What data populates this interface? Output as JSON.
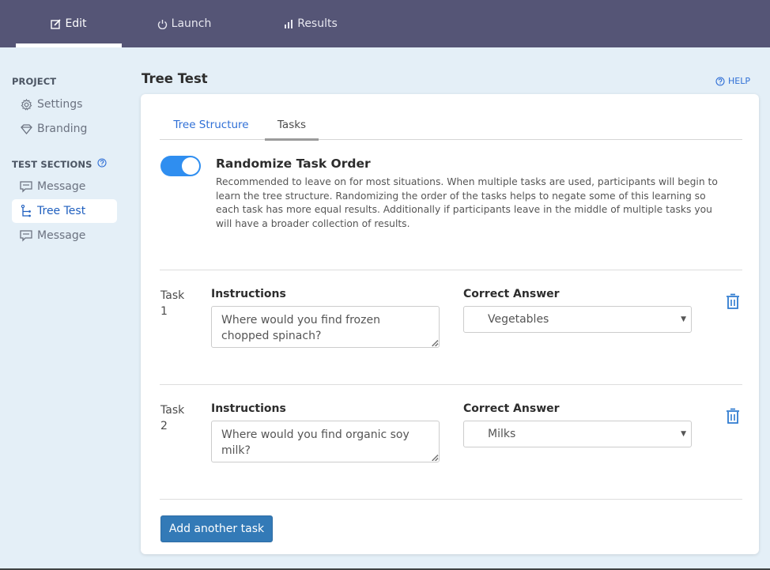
{
  "topnav": {
    "tabs": [
      {
        "label": "Edit",
        "icon": "edit-icon",
        "active": true
      },
      {
        "label": "Launch",
        "icon": "power-icon",
        "active": false
      },
      {
        "label": "Results",
        "icon": "bar-chart-icon",
        "active": false
      }
    ]
  },
  "sidebar": {
    "project_heading": "PROJECT",
    "project_items": [
      {
        "label": "Settings",
        "icon": "gear-icon"
      },
      {
        "label": "Branding",
        "icon": "diamond-icon"
      }
    ],
    "sections_heading": "TEST SECTIONS",
    "section_items": [
      {
        "label": "Message",
        "icon": "message-icon",
        "active": false
      },
      {
        "label": "Tree Test",
        "icon": "tree-icon",
        "active": true
      },
      {
        "label": "Message",
        "icon": "message-icon",
        "active": false
      }
    ]
  },
  "main": {
    "title": "Tree Test",
    "help_label": "HELP",
    "tabs": [
      {
        "label": "Tree Structure",
        "active": false
      },
      {
        "label": "Tasks",
        "active": true
      }
    ],
    "randomize": {
      "enabled": true,
      "title": "Randomize Task Order",
      "description": "Recommended to leave on for most situations. When multiple tasks are used, participants will begin to learn the tree structure. Randomizing the order of the tasks helps to negate some of this learning so each task has more equal results. Additionally if participants leave in the middle of multiple tasks you will have a broader collection of results."
    },
    "instructions_label": "Instructions",
    "answer_label": "Correct Answer",
    "tasks": [
      {
        "label": "Task 1",
        "instructions": "Where would you find frozen chopped spinach?",
        "answer": "Vegetables"
      },
      {
        "label": "Task 2",
        "instructions": "Where would you find organic soy milk?",
        "answer": "Milks"
      }
    ],
    "add_task_label": "Add another task"
  },
  "colors": {
    "topbar": "#555576",
    "accent": "#2f6fd6",
    "toggle_on": "#2f8ef0",
    "button": "#337ab7",
    "background": "#e4eff7"
  }
}
